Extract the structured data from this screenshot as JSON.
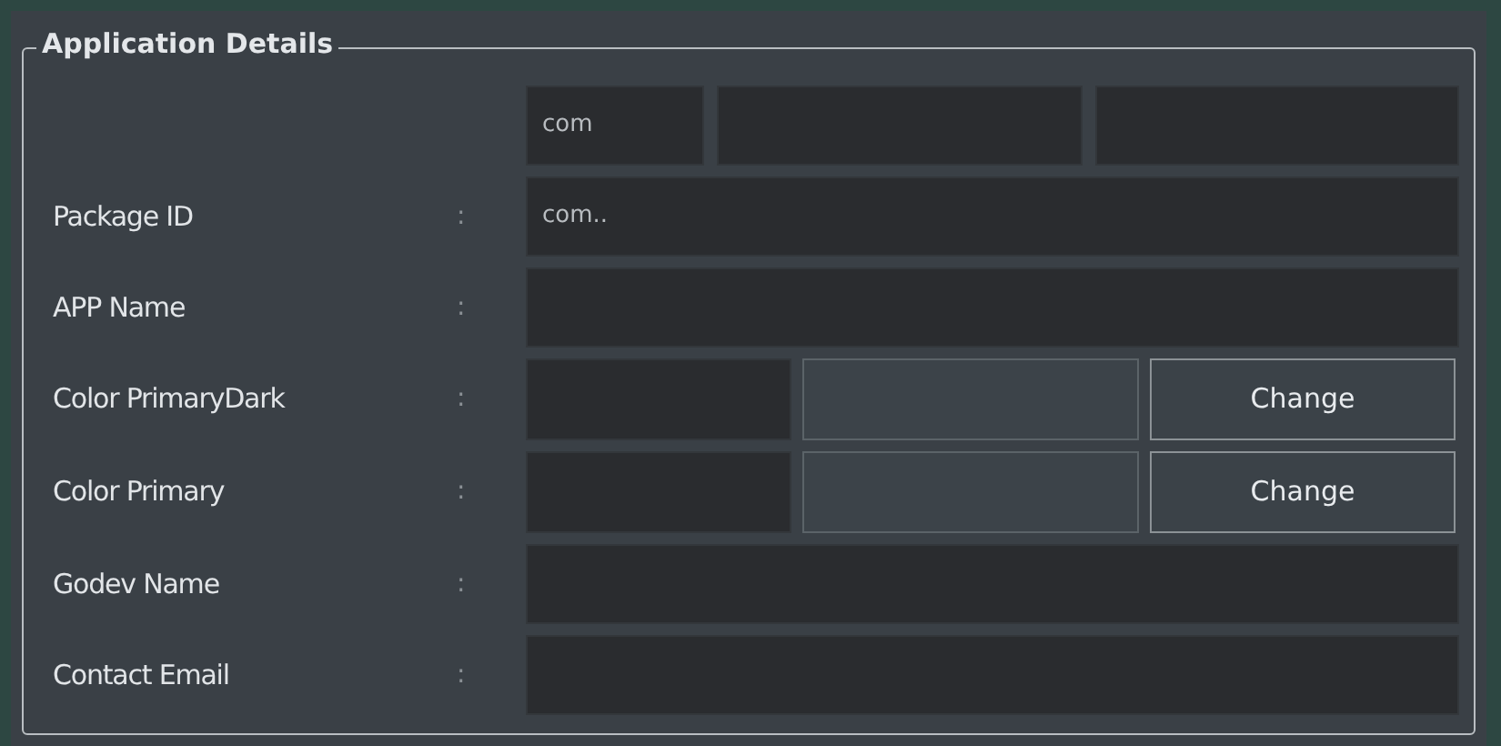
{
  "group": {
    "title": "Application Details"
  },
  "prefix_fields": [
    {
      "kind": "field",
      "value": "com"
    },
    {
      "kind": "field"
    },
    {
      "kind": "field"
    }
  ],
  "rows": [
    {
      "kind": "text",
      "label": "Package ID",
      "separator": ":",
      "value": "com.."
    },
    {
      "kind": "text",
      "label": "APP Name",
      "separator": ":"
    },
    {
      "kind": "color",
      "label": "Color PrimaryDark",
      "separator": ":",
      "button": "Change"
    },
    {
      "kind": "color",
      "label": "Color Primary",
      "separator": ":",
      "button": "Change"
    },
    {
      "kind": "text",
      "label": "Godev Name",
      "separator": ":"
    },
    {
      "kind": "text",
      "label": "Contact Email",
      "separator": ":"
    }
  ]
}
